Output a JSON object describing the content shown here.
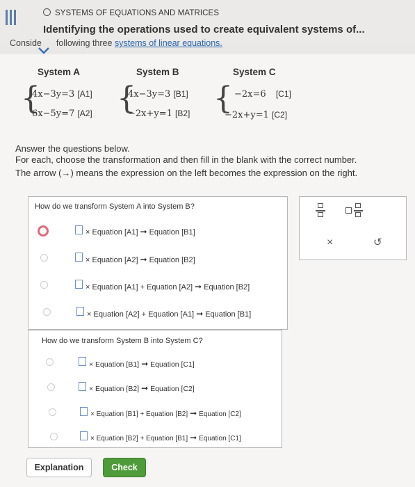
{
  "header": {
    "topic": "SYSTEMS OF EQUATIONS AND MATRICES",
    "title": "Identifying the operations used to create equivalent systems of...",
    "consider_prefix": "Conside",
    "consider_mid": "following three",
    "consider_link": "systems of linear equations."
  },
  "systems": [
    {
      "name": "System A",
      "eq1": "4x−3y=3",
      "tag1": "[A1]",
      "eq2": "6x−5y=7",
      "tag2": "[A2]"
    },
    {
      "name": "System B",
      "eq1": "4x−3y=3",
      "tag1": "[B1]",
      "eq2": "−2x+y=1",
      "tag2": "[B2]"
    },
    {
      "name": "System C",
      "eq1": "−2x=6",
      "tag1": "[C1]",
      "eq2": "−2x+y=1",
      "tag2": "[C2]"
    }
  ],
  "instructions": {
    "line1": "Answer the questions below.",
    "line2": "For each, choose the transformation and then fill in the blank with the correct number.",
    "line3a": "The arrow (",
    "arrow": "→",
    "line3b": ") means the expression on the left becomes the expression on the right."
  },
  "question1": {
    "prompt": "How do we transform System A into System B?",
    "options": [
      {
        "pre": "× Equation [A1]",
        "post": "Equation [B1]"
      },
      {
        "pre": "× Equation [A2]",
        "post": "Equation [B2]"
      },
      {
        "pre": "× Equation [A1] + Equation [A2]",
        "post": "Equation [B2]"
      },
      {
        "pre": "× Equation [A2] + Equation [A1]",
        "post": "Equation [B1]"
      }
    ]
  },
  "question2": {
    "prompt": "How do we transform System B into System C?",
    "options": [
      {
        "pre": "× Equation [B1]",
        "post": "Equation [C1]"
      },
      {
        "pre": "× Equation [B2]",
        "post": "Equation [C2]"
      },
      {
        "pre": "× Equation [B1] + Equation [B2]",
        "post": "Equation [C2]"
      },
      {
        "pre": "× Equation [B2] + Equation [B1]",
        "post": "Equation [C1]"
      }
    ]
  },
  "tools": {
    "close": "×",
    "undo": "↺"
  },
  "buttons": {
    "explanation": "Explanation",
    "check": "Check"
  },
  "colors": {
    "accent_blue": "#5a7fa8",
    "check_green": "#4f9b3a",
    "selected_radio": "#e06a78",
    "link": "#2a66b0"
  }
}
